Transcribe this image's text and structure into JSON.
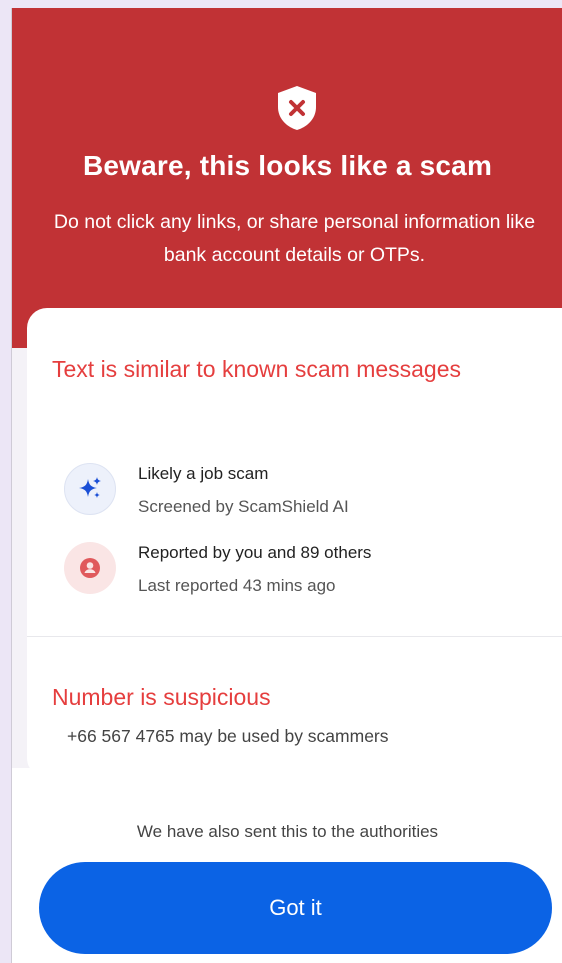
{
  "alert": {
    "title": "Beware, this looks like a scam",
    "subtitle": "Do not click any links, or share personal information like bank account details or OTPs.",
    "icon": "shield-x-icon",
    "color": "#c13235"
  },
  "message_section": {
    "title": "Text is similar to known scam messages",
    "reasons": [
      {
        "icon": "sparkles-icon",
        "title": "Likely a job scam",
        "subtitle": "Screened by ScamShield AI"
      },
      {
        "icon": "user-report-icon",
        "title": "Reported by you and 89 others",
        "subtitle": "Last reported 43 mins ago"
      }
    ]
  },
  "number_section": {
    "title": "Number is suspicious",
    "subtitle": "+66 567 4765 may be used by scammers"
  },
  "footer": {
    "note": "We have also sent this to the authorities",
    "button_label": "Got it",
    "button_color": "#0b63e5"
  }
}
